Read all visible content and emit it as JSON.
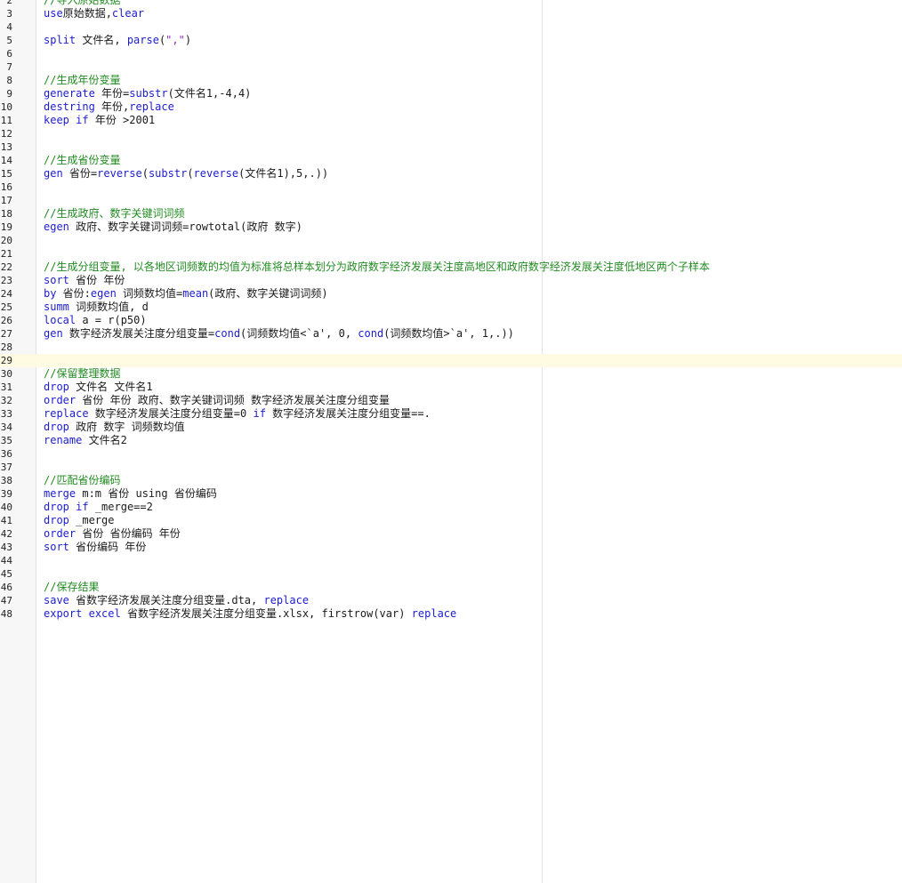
{
  "editor": {
    "current_line": 29,
    "lines": [
      {
        "n": "2",
        "t": [
          [
            "cm",
            "//导入原始数据"
          ]
        ]
      },
      {
        "n": "3",
        "t": [
          [
            "kw",
            "use"
          ],
          [
            "",
            "原始数据,"
          ],
          [
            "kw",
            "clear"
          ]
        ]
      },
      {
        "n": "4",
        "t": []
      },
      {
        "n": "5",
        "t": [
          [
            "kw",
            "split"
          ],
          [
            "",
            " 文件名, "
          ],
          [
            "kw",
            "parse"
          ],
          [
            "",
            "("
          ],
          [
            "str",
            "\",\""
          ],
          [
            "",
            ")"
          ]
        ]
      },
      {
        "n": "6",
        "t": []
      },
      {
        "n": "7",
        "t": []
      },
      {
        "n": "8",
        "t": [
          [
            "cm",
            "//生成年份变量"
          ]
        ]
      },
      {
        "n": "9",
        "t": [
          [
            "kw",
            "generate"
          ],
          [
            "",
            " 年份="
          ],
          [
            "fn",
            "substr"
          ],
          [
            "",
            "(文件名1,-4,4)"
          ]
        ]
      },
      {
        "n": "10",
        "t": [
          [
            "kw",
            "destring"
          ],
          [
            "",
            " 年份,"
          ],
          [
            "kw",
            "replace"
          ]
        ]
      },
      {
        "n": "11",
        "t": [
          [
            "kw",
            "keep"
          ],
          [
            "",
            " "
          ],
          [
            "kw",
            "if"
          ],
          [
            "",
            " 年份 >2001"
          ]
        ]
      },
      {
        "n": "12",
        "t": []
      },
      {
        "n": "13",
        "t": []
      },
      {
        "n": "14",
        "t": [
          [
            "cm",
            "//生成省份变量"
          ]
        ]
      },
      {
        "n": "15",
        "t": [
          [
            "kw",
            "gen"
          ],
          [
            "",
            " 省份="
          ],
          [
            "fn",
            "reverse"
          ],
          [
            "",
            "("
          ],
          [
            "fn",
            "substr"
          ],
          [
            "",
            "("
          ],
          [
            "fn",
            "reverse"
          ],
          [
            "",
            "(文件名1),5,.))"
          ]
        ]
      },
      {
        "n": "16",
        "t": []
      },
      {
        "n": "17",
        "t": []
      },
      {
        "n": "18",
        "t": [
          [
            "cm",
            "//生成政府、数字关键词词频"
          ]
        ]
      },
      {
        "n": "19",
        "t": [
          [
            "kw",
            "egen"
          ],
          [
            "",
            " 政府、数字关键词词频=rowtotal(政府 数字)"
          ]
        ]
      },
      {
        "n": "20",
        "t": []
      },
      {
        "n": "21",
        "t": []
      },
      {
        "n": "22",
        "t": [
          [
            "cm",
            "//生成分组变量, 以各地区词频数的均值为标准将总样本划分为政府数字经济发展关注度高地区和政府数字经济发展关注度低地区两个子样本"
          ]
        ]
      },
      {
        "n": "23",
        "t": [
          [
            "kw",
            "sort"
          ],
          [
            "",
            " 省份 年份"
          ]
        ]
      },
      {
        "n": "24",
        "t": [
          [
            "kw",
            "by"
          ],
          [
            "",
            " 省份:"
          ],
          [
            "kw",
            "egen"
          ],
          [
            "",
            " 词频数均值="
          ],
          [
            "fn",
            "mean"
          ],
          [
            "",
            "(政府、数字关键词词频)"
          ]
        ]
      },
      {
        "n": "25",
        "t": [
          [
            "kw",
            "summ"
          ],
          [
            "",
            " 词频数均值, d"
          ]
        ]
      },
      {
        "n": "26",
        "t": [
          [
            "kw",
            "local"
          ],
          [
            "",
            " a = r(p50)"
          ]
        ]
      },
      {
        "n": "27",
        "t": [
          [
            "kw",
            "gen"
          ],
          [
            "",
            " 数字经济发展关注度分组变量="
          ],
          [
            "fn",
            "cond"
          ],
          [
            "",
            "(词频数均值<`a', 0, "
          ],
          [
            "fn",
            "cond"
          ],
          [
            "",
            "(词频数均值>`a', 1,.))"
          ]
        ]
      },
      {
        "n": "28",
        "t": []
      },
      {
        "n": "29",
        "t": []
      },
      {
        "n": "30",
        "t": [
          [
            "cm",
            "//保留整理数据"
          ]
        ]
      },
      {
        "n": "31",
        "t": [
          [
            "kw",
            "drop"
          ],
          [
            "",
            " 文件名 文件名1"
          ]
        ]
      },
      {
        "n": "32",
        "t": [
          [
            "kw",
            "order"
          ],
          [
            "",
            " 省份 年份 政府、数字关键词词频 数字经济发展关注度分组变量"
          ]
        ]
      },
      {
        "n": "33",
        "t": [
          [
            "kw",
            "replace"
          ],
          [
            "",
            " 数字经济发展关注度分组变量=0 "
          ],
          [
            "kw",
            "if"
          ],
          [
            "",
            " 数字经济发展关注度分组变量==."
          ]
        ]
      },
      {
        "n": "34",
        "t": [
          [
            "kw",
            "drop"
          ],
          [
            "",
            " 政府 数字 词频数均值"
          ]
        ]
      },
      {
        "n": "35",
        "t": [
          [
            "kw",
            "rename"
          ],
          [
            "",
            " 文件名2"
          ]
        ]
      },
      {
        "n": "36",
        "t": []
      },
      {
        "n": "37",
        "t": []
      },
      {
        "n": "38",
        "t": [
          [
            "cm",
            "//匹配省份编码"
          ]
        ]
      },
      {
        "n": "39",
        "t": [
          [
            "kw",
            "merge"
          ],
          [
            "",
            " m:m 省份 using 省份编码"
          ]
        ]
      },
      {
        "n": "40",
        "t": [
          [
            "kw",
            "drop"
          ],
          [
            "",
            " "
          ],
          [
            "kw",
            "if"
          ],
          [
            "",
            " _merge==2"
          ]
        ]
      },
      {
        "n": "41",
        "t": [
          [
            "kw",
            "drop"
          ],
          [
            "",
            " _merge"
          ]
        ]
      },
      {
        "n": "42",
        "t": [
          [
            "kw",
            "order"
          ],
          [
            "",
            " 省份 省份编码 年份"
          ]
        ]
      },
      {
        "n": "43",
        "t": [
          [
            "kw",
            "sort"
          ],
          [
            "",
            " 省份编码 年份"
          ]
        ]
      },
      {
        "n": "44",
        "t": []
      },
      {
        "n": "45",
        "t": []
      },
      {
        "n": "46",
        "t": [
          [
            "cm",
            "//保存结果"
          ]
        ]
      },
      {
        "n": "47",
        "t": [
          [
            "kw",
            "save"
          ],
          [
            "",
            " 省数字经济发展关注度分组变量.dta, "
          ],
          [
            "kw",
            "replace"
          ]
        ]
      },
      {
        "n": "48",
        "t": [
          [
            "kw",
            "export"
          ],
          [
            "",
            " "
          ],
          [
            "kw",
            "excel"
          ],
          [
            "",
            " 省数字经济发展关注度分组变量.xlsx, firstrow(var) "
          ],
          [
            "kw",
            "replace"
          ]
        ]
      }
    ]
  }
}
